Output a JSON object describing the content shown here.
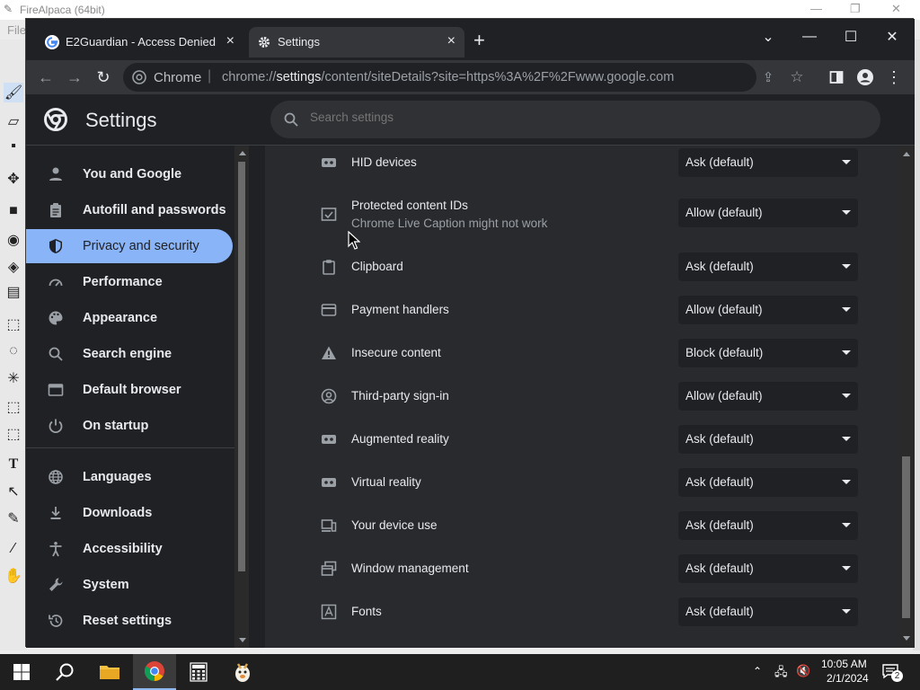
{
  "background_app": {
    "title": "FireAlpaca (64bit)",
    "menu_partial": "File"
  },
  "browser": {
    "tabs": [
      {
        "label": "E2Guardian - Access Denied",
        "active": false,
        "favicon": "google-g-icon"
      },
      {
        "label": "Settings",
        "active": true,
        "favicon": "gear-icon"
      }
    ],
    "omnibox": {
      "site_label": "Chrome",
      "separator": "|",
      "url_prefix": "chrome://",
      "url_host": "settings",
      "url_path": "/content/siteDetails?site=https%3A%2F%2Fwww.google.com"
    }
  },
  "settings": {
    "title": "Settings",
    "search_placeholder": "Search settings",
    "nav": [
      {
        "label": "You and Google",
        "icon": "person-icon"
      },
      {
        "label": "Autofill and passwords",
        "icon": "clipboard-icon"
      },
      {
        "label": "Privacy and security",
        "icon": "shield-icon",
        "active": true
      },
      {
        "label": "Performance",
        "icon": "speedometer-icon"
      },
      {
        "label": "Appearance",
        "icon": "palette-icon"
      },
      {
        "label": "Search engine",
        "icon": "search-icon"
      },
      {
        "label": "Default browser",
        "icon": "browser-window-icon"
      },
      {
        "label": "On startup",
        "icon": "power-icon"
      },
      {
        "label": "Languages",
        "icon": "globe-icon"
      },
      {
        "label": "Downloads",
        "icon": "download-icon"
      },
      {
        "label": "Accessibility",
        "icon": "accessibility-icon"
      },
      {
        "label": "System",
        "icon": "wrench-icon"
      },
      {
        "label": "Reset settings",
        "icon": "reset-history-icon"
      }
    ],
    "permissions": [
      {
        "label": "HID devices",
        "value": "Ask (default)",
        "icon": "hid-device-icon"
      },
      {
        "label": "Protected content IDs",
        "sublabel": "Chrome Live Caption might not work",
        "value": "Allow (default)",
        "icon": "protected-content-icon"
      },
      {
        "label": "Clipboard",
        "value": "Ask (default)",
        "icon": "clipboard-icon"
      },
      {
        "label": "Payment handlers",
        "value": "Allow (default)",
        "icon": "card-icon"
      },
      {
        "label": "Insecure content",
        "value": "Block (default)",
        "icon": "warning-icon"
      },
      {
        "label": "Third-party sign-in",
        "value": "Allow (default)",
        "icon": "account-circle-icon"
      },
      {
        "label": "Augmented reality",
        "value": "Ask (default)",
        "icon": "ar-headset-icon"
      },
      {
        "label": "Virtual reality",
        "value": "Ask (default)",
        "icon": "vr-headset-icon"
      },
      {
        "label": "Your device use",
        "value": "Ask (default)",
        "icon": "devices-icon"
      },
      {
        "label": "Window management",
        "value": "Ask (default)",
        "icon": "window-management-icon"
      },
      {
        "label": "Fonts",
        "value": "Ask (default)",
        "icon": "font-icon"
      }
    ]
  },
  "taskbar": {
    "apps": [
      "start-icon",
      "search-icon",
      "file-explorer-icon",
      "chrome-icon",
      "calculator-icon",
      "firealpaca-icon"
    ],
    "time": "10:05 AM",
    "date": "2/1/2024",
    "notifications": "2"
  },
  "colors": {
    "accent": "#8ab4f8",
    "page_bg": "#202124",
    "content_bg": "#292a2d"
  }
}
